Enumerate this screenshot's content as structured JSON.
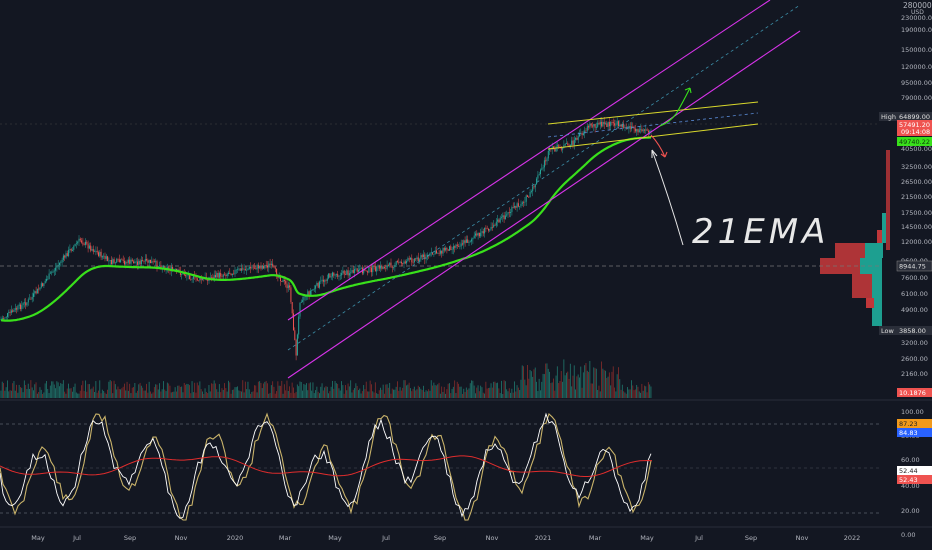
{
  "chart_data": {
    "type": "candlestick",
    "instrument": "BTC",
    "main_axis": {
      "scale": "log",
      "tick_labels": [
        "230000.00",
        "190000.00",
        "150000.00",
        "120000.00",
        "95000.00",
        "79000.00",
        "64899.00",
        "40500.00",
        "32500.00",
        "26500.00",
        "21500.00",
        "17500.00",
        "14500.00",
        "12000.00",
        "9600.00",
        "7600.00",
        "6100.00",
        "4900.00",
        "3858.00",
        "3200.00",
        "2600.00",
        "2160.00"
      ],
      "top_label": "280000.00"
    },
    "x_axis_labels": [
      "May",
      "Jul",
      "Sep",
      "Nov",
      "2020",
      "Mar",
      "May",
      "Jul",
      "Sep",
      "Nov",
      "2021",
      "Mar",
      "May",
      "Jul",
      "Sep",
      "Nov",
      "2022"
    ],
    "price_badges": {
      "high_label": "High",
      "high_value": "64899.00",
      "low_label": "Low",
      "low_value": "3858.00",
      "last_price": "57491.20",
      "countdown": "09:14:08",
      "ema_value": "49740.22",
      "cursor_price": "8944.75",
      "volume_value": "10.1876"
    },
    "oscillator_axis": {
      "tick_labels": [
        "100.00",
        "80.00",
        "60.00",
        "40.00",
        "20.00",
        "0.00"
      ],
      "badges": [
        "87.23",
        "84.83",
        "52.44",
        "52.43"
      ]
    },
    "annotation_text": "21EMA",
    "colors": {
      "background": "#131722",
      "up": "#26a69a",
      "down": "#ef5350",
      "ema": "#39e01b",
      "channel": "#d633e8",
      "triangle": "#d9d82c",
      "k_line": "#c9b36a",
      "d_line": "#ffffff",
      "signal": "#e02d2d"
    }
  }
}
